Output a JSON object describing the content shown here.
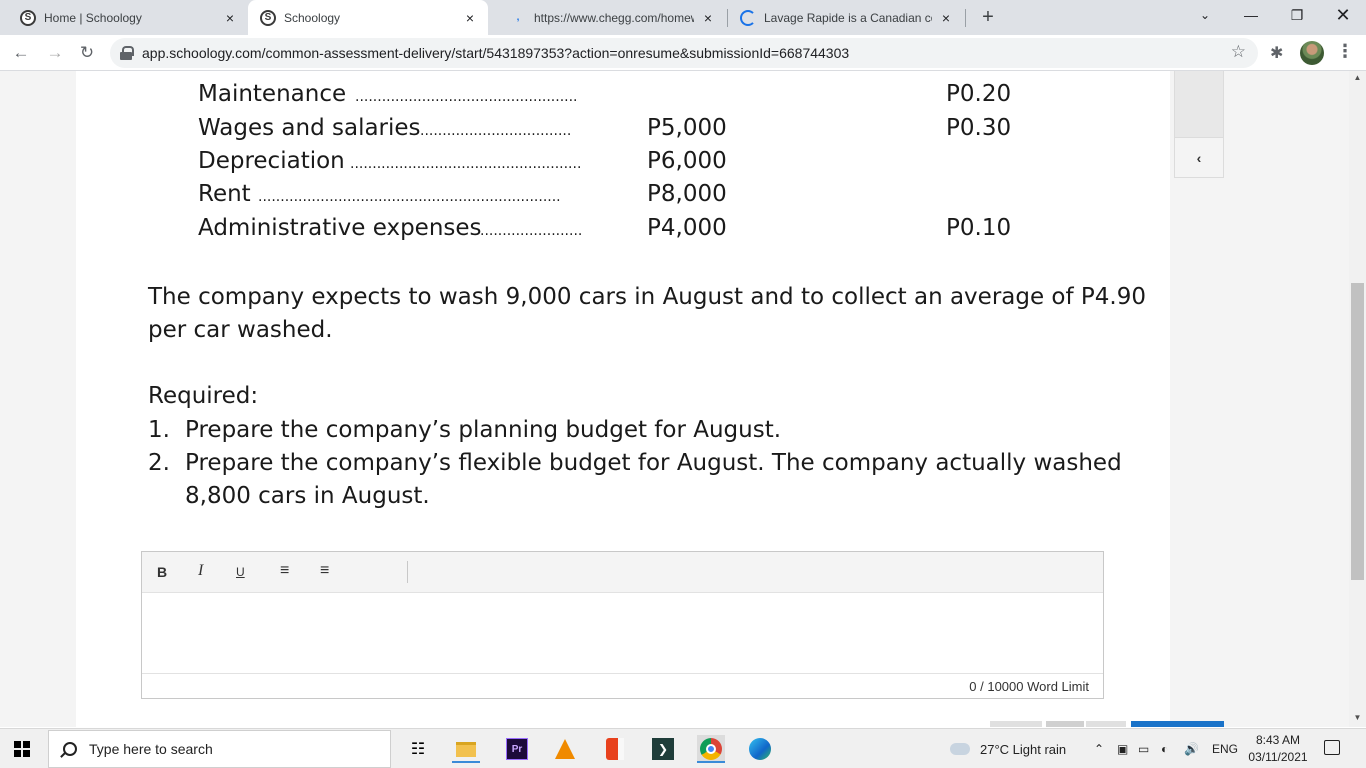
{
  "browser": {
    "tabs": [
      {
        "title": "Home | Schoology",
        "icon": "schoology-icon"
      },
      {
        "title": "Schoology",
        "icon": "schoology-icon"
      },
      {
        "title": "https://www.chegg.com/homewo",
        "icon": "chegg-icon"
      },
      {
        "title": "Lavage Rapide is a Canadian com",
        "icon": "loading-icon"
      }
    ],
    "close_glyph": "×",
    "new_tab_glyph": "+",
    "url": "app.schoology.com/common-assessment-delivery/start/5431897353?action=onresume&submissionId=668744303"
  },
  "page": {
    "cost_rows": [
      {
        "label": "Maintenance",
        "fixed": "",
        "variable": "P0.20"
      },
      {
        "label": "Wages and salaries",
        "fixed": "P5,000",
        "variable": "P0.30"
      },
      {
        "label": "Depreciation",
        "fixed": "P6,000",
        "variable": ""
      },
      {
        "label": "Rent",
        "fixed": "P8,000",
        "variable": ""
      },
      {
        "label": "Administrative expenses",
        "fixed": "P4,000",
        "variable": "P0.10"
      }
    ],
    "paragraph_line1": "The company expects to wash 9,000 cars in August and to collect an average of P4.90",
    "paragraph_line2": "per car washed.",
    "required_heading": "Required:",
    "required_items": [
      {
        "num": "1.",
        "line1": "Prepare the company’s planning budget for August.",
        "line2": ""
      },
      {
        "num": "2.",
        "line1": "Prepare the company’s flexible budget for August. The company actually washed",
        "line2": "8,800 cars in August."
      }
    ],
    "collapse_glyph": "‹"
  },
  "editor": {
    "bold_label": "B",
    "italic_label": "I",
    "underline_label": "U",
    "word_limit": "0 / 10000 Word Limit"
  },
  "taskbar": {
    "search_placeholder": "Type here to search",
    "weather": "27°C  Light rain",
    "language": "ENG",
    "time": "8:43 AM",
    "date": "03/11/2021"
  }
}
